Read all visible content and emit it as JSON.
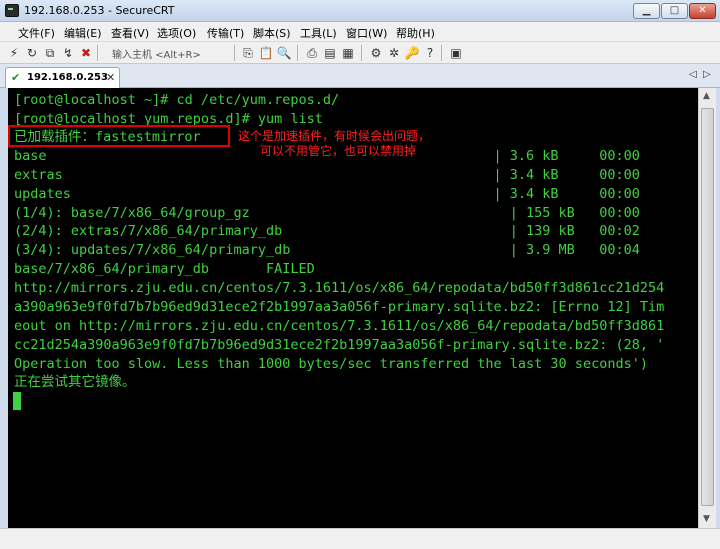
{
  "window": {
    "title": "192.168.0.253 - SecureCRT",
    "min_glyph": "▁",
    "max_glyph": "□",
    "close_glyph": "✕"
  },
  "menu": [
    "文件(F)",
    "编辑(E)",
    "查看(V)",
    "选项(O)",
    "传输(T)",
    "脚本(S)",
    "工具(L)",
    "窗口(W)",
    "帮助(H)"
  ],
  "toolbar": {
    "quick_connect_placeholder": "输入主机 <Alt+R>",
    "icons": [
      "connect-icon",
      "reconnect-icon",
      "connect-in-tab-icon",
      "quick-connect-icon",
      "disconnect-icon",
      "copy-icon",
      "paste-icon",
      "find-icon",
      "print-icon",
      "session-options-icon",
      "global-options-icon",
      "key-generator-icon",
      "help-icon",
      "sftp-icon"
    ]
  },
  "tab": {
    "label": "192.168.0.253",
    "status_glyph": "✔",
    "close_glyph": "✕",
    "left_arrow": "◁",
    "right_arrow": "▷"
  },
  "terminal": {
    "lines": [
      "[root@localhost ~]# cd /etc/yum.repos.d/",
      "[root@localhost yum.repos.d]# yum list",
      "已加载插件：fastestmirror",
      "base                                                       | 3.6 kB     00:00",
      "extras                                                     | 3.4 kB     00:00",
      "updates                                                    | 3.4 kB     00:00",
      "(1/4): base/7/x86_64/group_gz                                | 155 kB   00:00",
      "(2/4): extras/7/x86_64/primary_db                            | 139 kB   00:02",
      "(3/4): updates/7/x86_64/primary_db                           | 3.9 MB   00:04",
      "base/7/x86_64/primary_db       FAILED",
      "http://mirrors.zju.edu.cn/centos/7.3.1611/os/x86_64/repodata/bd50ff3d861cc21d254",
      "a390a963e9f0fd7b7b96ed9d31ece2f2b1997aa3a056f-primary.sqlite.bz2: [Errno 12] Tim",
      "eout on http://mirrors.zju.edu.cn/centos/7.3.1611/os/x86_64/repodata/bd50ff3d861",
      "cc21d254a390a963e9f0fd7b7b96ed9d31ece2f2b1997aa3a056f-primary.sqlite.bz2: (28, '",
      "Operation too slow. Less than 1000 bytes/sec transferred the last 30 seconds')",
      "正在尝试其它镜像。"
    ]
  },
  "annotations": {
    "line1": "这个是加速插件，有时候会出问题，",
    "line2": "可以不用管它，也可以禁用掉"
  },
  "scrollbar": {
    "up_glyph": "▲",
    "down_glyph": "▼"
  },
  "colors": {
    "terminal_fg": "#40d040",
    "terminal_bg": "#000000",
    "annotation": "#ff2020"
  }
}
